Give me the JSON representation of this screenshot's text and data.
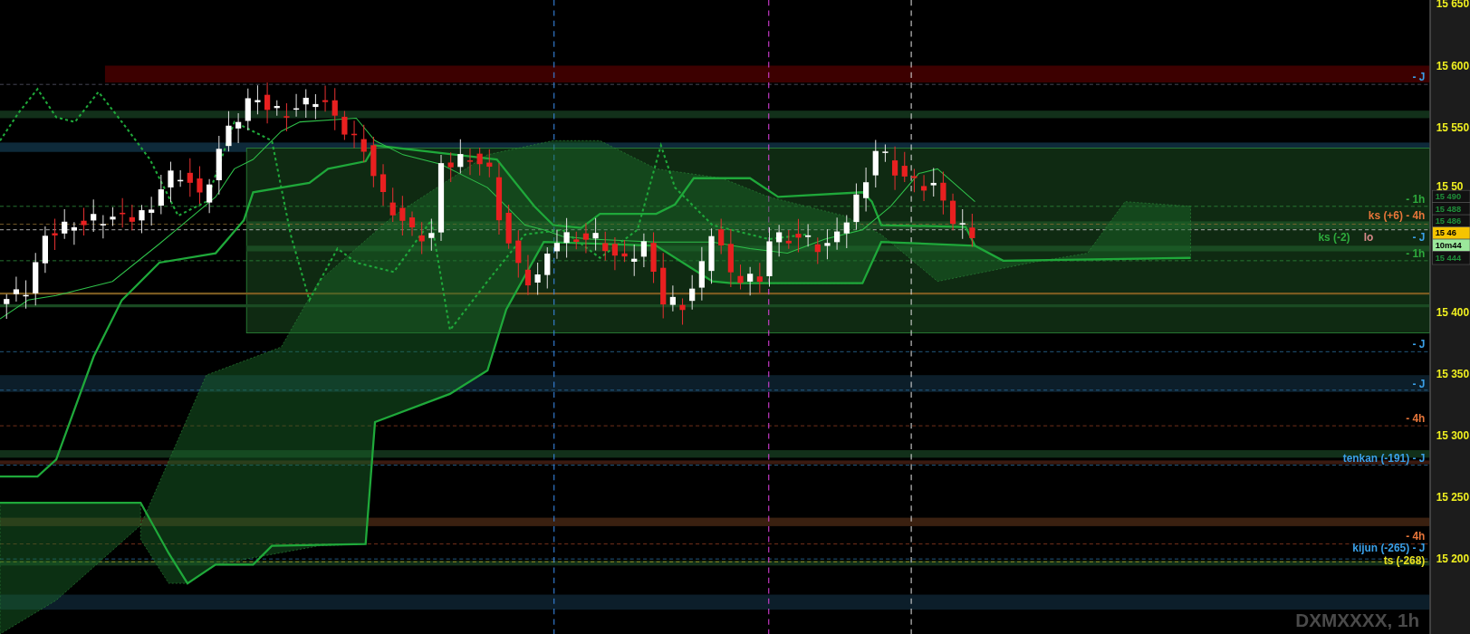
{
  "chart": {
    "symbol_label": "DXMXXXX, 1h",
    "price_axis": {
      "ticks": [
        "15 650",
        "15 600",
        "15 550",
        "15 50",
        "15 400",
        "15 350",
        "15 300",
        "15 250",
        "15 200"
      ]
    },
    "level_labels": [
      {
        "text": "- J",
        "color": "#3aa0e8"
      },
      {
        "text": "- 1h",
        "color": "#2eaa3c"
      },
      {
        "text": "ks (+6) - 4h",
        "color": "#e8763a"
      },
      {
        "text": "ks (-2)",
        "color": "#2eaa3c"
      },
      {
        "text": "lo",
        "color": "#d88a8a"
      },
      {
        "text": "- J",
        "color": "#3aa0e8"
      },
      {
        "text": "- 1h",
        "color": "#2eaa3c"
      },
      {
        "text": "- J",
        "color": "#3aa0e8"
      },
      {
        "text": "- J",
        "color": "#3aa0e8"
      },
      {
        "text": "- 4h",
        "color": "#e8763a"
      },
      {
        "text": "tenkan (-191) - J",
        "color": "#3aa0e8"
      },
      {
        "text": "- 4h",
        "color": "#e8763a"
      },
      {
        "text": "kijun (-265) - J",
        "color": "#3aa0e8"
      },
      {
        "text": "ts (-268)",
        "color": "#e8e020"
      }
    ],
    "price_tags": [
      {
        "text": "15 490",
        "kind": "level"
      },
      {
        "text": "15 488",
        "kind": "level"
      },
      {
        "text": "15 486",
        "kind": "level"
      },
      {
        "text": "15 46",
        "kind": "last"
      },
      {
        "text": "10m44",
        "kind": "timer"
      },
      {
        "text": "15 444",
        "kind": "level"
      }
    ]
  }
}
